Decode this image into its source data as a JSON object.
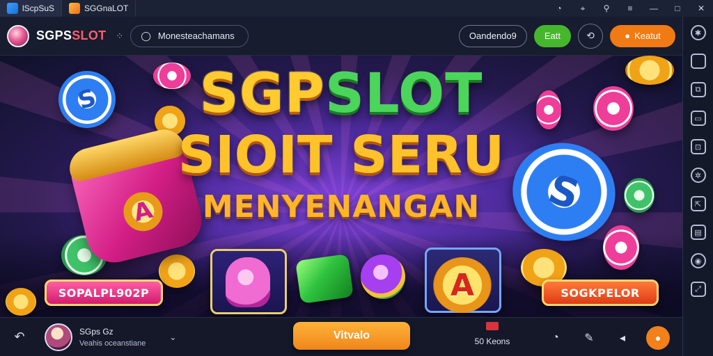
{
  "window": {
    "tabs": [
      {
        "label": "lScpSuS"
      },
      {
        "label": "SGGnaLOT"
      }
    ]
  },
  "appbar": {
    "brand_main": "SGPS",
    "brand_accent": "SLOT",
    "search": {
      "placeholder": "Monesteachamans"
    },
    "buttons": {
      "outline_label": "Oandendo9",
      "green_label": "Eatt",
      "orange_label": "Keatut"
    }
  },
  "hero": {
    "title_part1": "SGP",
    "title_part2": "SLOT",
    "line2": "SIOIT SERU",
    "line3": "MENYENANGAN",
    "chip_letter": "S",
    "cannon_letter": "A",
    "coin_letter": "A",
    "btn_left": "SOPALPL902P",
    "btn_right": "SOGKPELOR"
  },
  "bottombar": {
    "user_name": "SGps Gz",
    "user_sub": "Veahis oceanstiane",
    "primary_label": "Vitvalo",
    "stat_label": "50 Keons"
  },
  "colors": {
    "accent_orange": "#f07a14",
    "accent_green": "#46b62c",
    "brand_red": "#ff5d6c"
  },
  "icons": {
    "titlebar": [
      "bell-icon",
      "compass-icon",
      "pin-icon",
      "menu-icon",
      "minimize-icon",
      "maximize-icon",
      "close-icon"
    ],
    "sidebar": [
      "settings-icon",
      "window-icon",
      "copy-icon",
      "monitor-icon",
      "frame-icon",
      "gear-icon",
      "share-icon",
      "screen-icon",
      "record-icon",
      "expand-icon"
    ],
    "bottom": [
      "back-icon",
      "help-icon",
      "edit-icon",
      "sound-icon",
      "power-icon"
    ]
  }
}
